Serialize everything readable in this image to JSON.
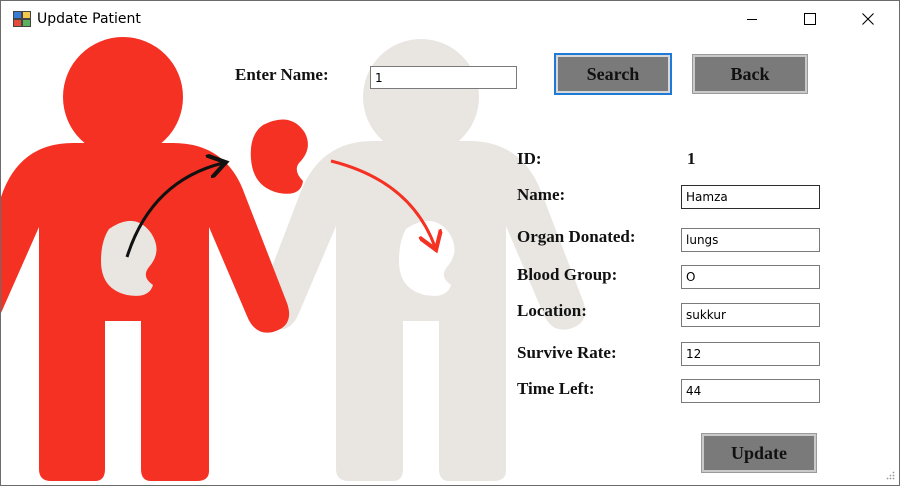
{
  "window": {
    "title": "Update Patient",
    "controls": [
      "minimize-icon",
      "maximize-icon",
      "close-icon"
    ]
  },
  "search": {
    "label": "Enter Name:",
    "value": "1",
    "search_button": "Search",
    "back_button": "Back"
  },
  "form": {
    "id_label": "ID:",
    "id_value": "1",
    "name_label": "Name:",
    "name_value": "Hamza",
    "organ_label": "Organ Donated:",
    "organ_value": "lungs",
    "blood_label": "Blood Group:",
    "blood_value": "O",
    "location_label": "Location:",
    "location_value": "sukkur",
    "survive_label": "Survive Rate:",
    "survive_value": "12",
    "time_label": "Time Left:",
    "time_value": "44",
    "update_button": "Update"
  },
  "colors": {
    "donor": "#f43123",
    "recipient": "#e9e6e2",
    "button": "#7a7a7a",
    "focus": "#1e7ad8"
  }
}
